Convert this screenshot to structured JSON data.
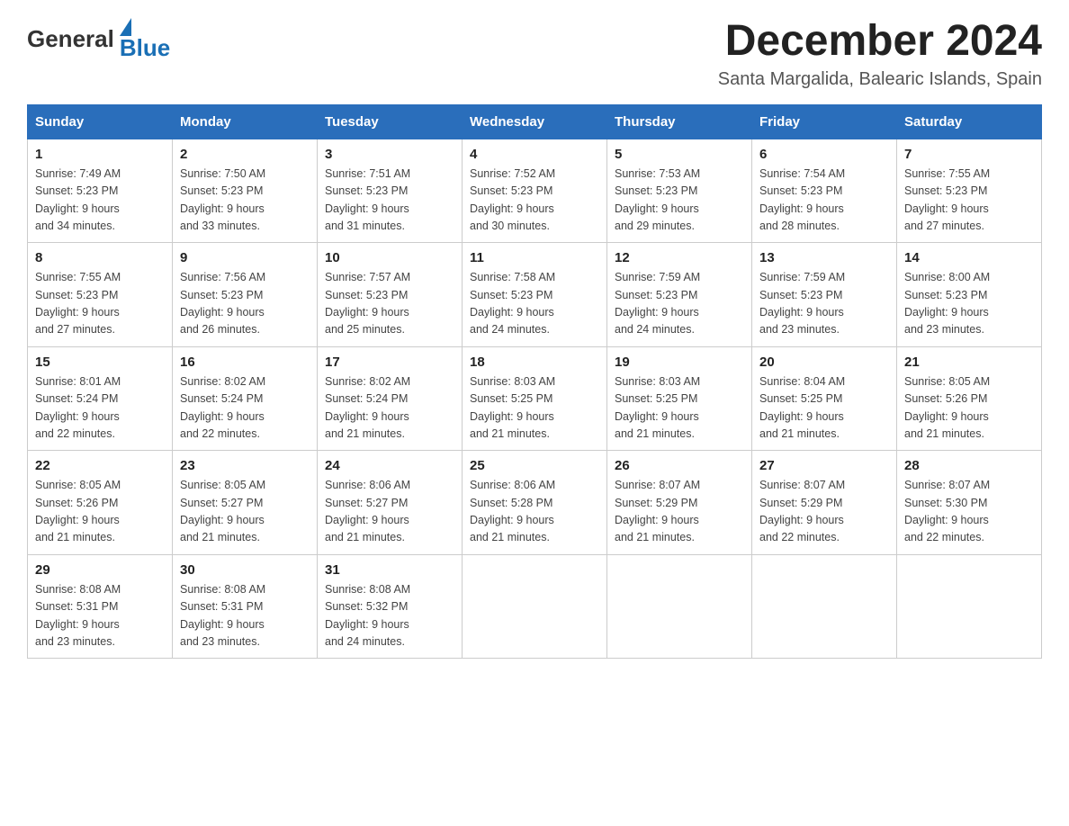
{
  "header": {
    "logo": {
      "text_general": "General",
      "text_blue": "Blue"
    },
    "title": "December 2024",
    "location": "Santa Margalida, Balearic Islands, Spain"
  },
  "days_of_week": [
    "Sunday",
    "Monday",
    "Tuesday",
    "Wednesday",
    "Thursday",
    "Friday",
    "Saturday"
  ],
  "weeks": [
    [
      {
        "day": "1",
        "sunrise": "7:49 AM",
        "sunset": "5:23 PM",
        "daylight": "9 hours and 34 minutes."
      },
      {
        "day": "2",
        "sunrise": "7:50 AM",
        "sunset": "5:23 PM",
        "daylight": "9 hours and 33 minutes."
      },
      {
        "day": "3",
        "sunrise": "7:51 AM",
        "sunset": "5:23 PM",
        "daylight": "9 hours and 31 minutes."
      },
      {
        "day": "4",
        "sunrise": "7:52 AM",
        "sunset": "5:23 PM",
        "daylight": "9 hours and 30 minutes."
      },
      {
        "day": "5",
        "sunrise": "7:53 AM",
        "sunset": "5:23 PM",
        "daylight": "9 hours and 29 minutes."
      },
      {
        "day": "6",
        "sunrise": "7:54 AM",
        "sunset": "5:23 PM",
        "daylight": "9 hours and 28 minutes."
      },
      {
        "day": "7",
        "sunrise": "7:55 AM",
        "sunset": "5:23 PM",
        "daylight": "9 hours and 27 minutes."
      }
    ],
    [
      {
        "day": "8",
        "sunrise": "7:55 AM",
        "sunset": "5:23 PM",
        "daylight": "9 hours and 27 minutes."
      },
      {
        "day": "9",
        "sunrise": "7:56 AM",
        "sunset": "5:23 PM",
        "daylight": "9 hours and 26 minutes."
      },
      {
        "day": "10",
        "sunrise": "7:57 AM",
        "sunset": "5:23 PM",
        "daylight": "9 hours and 25 minutes."
      },
      {
        "day": "11",
        "sunrise": "7:58 AM",
        "sunset": "5:23 PM",
        "daylight": "9 hours and 24 minutes."
      },
      {
        "day": "12",
        "sunrise": "7:59 AM",
        "sunset": "5:23 PM",
        "daylight": "9 hours and 24 minutes."
      },
      {
        "day": "13",
        "sunrise": "7:59 AM",
        "sunset": "5:23 PM",
        "daylight": "9 hours and 23 minutes."
      },
      {
        "day": "14",
        "sunrise": "8:00 AM",
        "sunset": "5:23 PM",
        "daylight": "9 hours and 23 minutes."
      }
    ],
    [
      {
        "day": "15",
        "sunrise": "8:01 AM",
        "sunset": "5:24 PM",
        "daylight": "9 hours and 22 minutes."
      },
      {
        "day": "16",
        "sunrise": "8:02 AM",
        "sunset": "5:24 PM",
        "daylight": "9 hours and 22 minutes."
      },
      {
        "day": "17",
        "sunrise": "8:02 AM",
        "sunset": "5:24 PM",
        "daylight": "9 hours and 21 minutes."
      },
      {
        "day": "18",
        "sunrise": "8:03 AM",
        "sunset": "5:25 PM",
        "daylight": "9 hours and 21 minutes."
      },
      {
        "day": "19",
        "sunrise": "8:03 AM",
        "sunset": "5:25 PM",
        "daylight": "9 hours and 21 minutes."
      },
      {
        "day": "20",
        "sunrise": "8:04 AM",
        "sunset": "5:25 PM",
        "daylight": "9 hours and 21 minutes."
      },
      {
        "day": "21",
        "sunrise": "8:05 AM",
        "sunset": "5:26 PM",
        "daylight": "9 hours and 21 minutes."
      }
    ],
    [
      {
        "day": "22",
        "sunrise": "8:05 AM",
        "sunset": "5:26 PM",
        "daylight": "9 hours and 21 minutes."
      },
      {
        "day": "23",
        "sunrise": "8:05 AM",
        "sunset": "5:27 PM",
        "daylight": "9 hours and 21 minutes."
      },
      {
        "day": "24",
        "sunrise": "8:06 AM",
        "sunset": "5:27 PM",
        "daylight": "9 hours and 21 minutes."
      },
      {
        "day": "25",
        "sunrise": "8:06 AM",
        "sunset": "5:28 PM",
        "daylight": "9 hours and 21 minutes."
      },
      {
        "day": "26",
        "sunrise": "8:07 AM",
        "sunset": "5:29 PM",
        "daylight": "9 hours and 21 minutes."
      },
      {
        "day": "27",
        "sunrise": "8:07 AM",
        "sunset": "5:29 PM",
        "daylight": "9 hours and 22 minutes."
      },
      {
        "day": "28",
        "sunrise": "8:07 AM",
        "sunset": "5:30 PM",
        "daylight": "9 hours and 22 minutes."
      }
    ],
    [
      {
        "day": "29",
        "sunrise": "8:08 AM",
        "sunset": "5:31 PM",
        "daylight": "9 hours and 23 minutes."
      },
      {
        "day": "30",
        "sunrise": "8:08 AM",
        "sunset": "5:31 PM",
        "daylight": "9 hours and 23 minutes."
      },
      {
        "day": "31",
        "sunrise": "8:08 AM",
        "sunset": "5:32 PM",
        "daylight": "9 hours and 24 minutes."
      },
      null,
      null,
      null,
      null
    ]
  ],
  "labels": {
    "sunrise": "Sunrise:",
    "sunset": "Sunset:",
    "daylight": "Daylight:"
  }
}
